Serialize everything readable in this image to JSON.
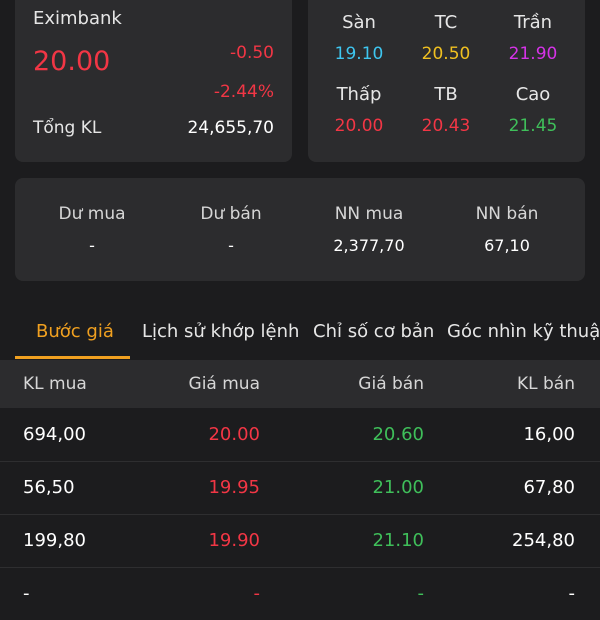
{
  "quote": {
    "name": "Eximbank",
    "price": "20.00",
    "change": "-0.50",
    "change_pct": "-2.44%",
    "volume_label": "Tổng KL",
    "volume_value": "24,655,70"
  },
  "range": {
    "san_label": "Sàn",
    "san_value": "19.10",
    "tc_label": "TC",
    "tc_value": "20.50",
    "tran_label": "Trần",
    "tran_value": "21.90",
    "thap_label": "Thấp",
    "thap_value": "20.00",
    "tb_label": "TB",
    "tb_value": "20.43",
    "cao_label": "Cao",
    "cao_value": "21.45"
  },
  "flow": {
    "du_mua_label": "Dư mua",
    "du_mua_value": "-",
    "du_ban_label": "Dư bán",
    "du_ban_value": "-",
    "nn_mua_label": "NN mua",
    "nn_mua_value": "2,377,70",
    "nn_ban_label": "NN bán",
    "nn_ban_value": "67,10"
  },
  "tabs": [
    {
      "label": "Bước giá"
    },
    {
      "label": "Lịch sử khớp lệnh"
    },
    {
      "label": "Chỉ số cơ bản"
    },
    {
      "label": "Góc nhìn kỹ thuậ"
    }
  ],
  "book": {
    "headers": {
      "kl_mua": "KL mua",
      "gia_mua": "Giá mua",
      "gia_ban": "Giá bán",
      "kl_ban": "KL bán"
    },
    "rows": [
      {
        "kl_mua": "694,00",
        "gia_mua": "20.00",
        "gia_ban": "20.60",
        "kl_ban": "16,00"
      },
      {
        "kl_mua": "56,50",
        "gia_mua": "19.95",
        "gia_ban": "21.00",
        "kl_ban": "67,80"
      },
      {
        "kl_mua": "199,80",
        "gia_mua": "19.90",
        "gia_ban": "21.10",
        "kl_ban": "254,80"
      },
      {
        "kl_mua": "-",
        "gia_mua": "-",
        "gia_ban": "-",
        "kl_ban": "-"
      }
    ]
  },
  "colors": {
    "floor": "#3ec6f0",
    "reference": "#f0c020",
    "ceiling": "#d633e8",
    "down": "#f23645",
    "up": "#3fbf5a",
    "accent": "#f0a020"
  }
}
